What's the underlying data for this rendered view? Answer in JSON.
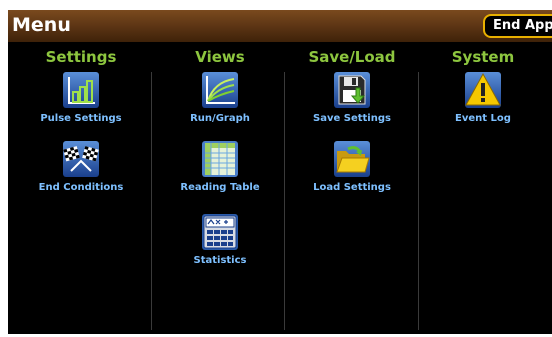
{
  "header": {
    "title": "Menu",
    "end_app_label": "End App"
  },
  "columns": [
    {
      "heading": "Settings",
      "items": [
        {
          "label": "Pulse Settings",
          "icon": "bar-chart-icon"
        },
        {
          "label": "End Conditions",
          "icon": "checkered-flag-icon"
        }
      ]
    },
    {
      "heading": "Views",
      "items": [
        {
          "label": "Run/Graph",
          "icon": "graph-curves-icon"
        },
        {
          "label": "Reading Table",
          "icon": "table-icon"
        },
        {
          "label": "Statistics",
          "icon": "calculator-icon"
        }
      ]
    },
    {
      "heading": "Save/Load",
      "items": [
        {
          "label": "Save Settings",
          "icon": "save-disk-icon"
        },
        {
          "label": "Load Settings",
          "icon": "folder-open-icon"
        }
      ]
    },
    {
      "heading": "System",
      "items": [
        {
          "label": "Event Log",
          "icon": "warning-icon"
        }
      ]
    }
  ],
  "colors": {
    "header_bar": "#5a3313",
    "end_app_border": "#e8b000",
    "column_heading": "#8dc63f",
    "item_label": "#7ec0ff",
    "background": "#000000"
  }
}
